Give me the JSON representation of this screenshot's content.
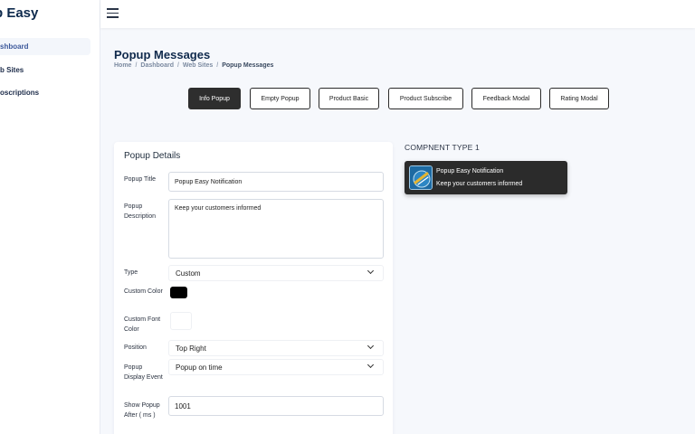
{
  "sidebar": {
    "brand": "p Easy",
    "items": [
      {
        "label": "shboard",
        "active": true
      },
      {
        "label": "b Sites",
        "active": false
      },
      {
        "label": "oscriptions",
        "active": false
      }
    ]
  },
  "header": {
    "menu_icon": "hamburger-icon"
  },
  "page": {
    "title": "Popup Messages",
    "breadcrumb": [
      "Home",
      "Dashboard",
      "Web Sites",
      "Popup Messages"
    ],
    "breadcrumb_separator": "/"
  },
  "tabs": [
    {
      "label": "Info Popup",
      "active": true
    },
    {
      "label": "Empty Popup",
      "active": false
    },
    {
      "label": "Product Basic",
      "active": false
    },
    {
      "label": "Product Subscribe",
      "active": false
    },
    {
      "label": "Feedback Modal",
      "active": false
    },
    {
      "label": "Rating Modal",
      "active": false
    }
  ],
  "form": {
    "title": "Popup Details",
    "popup_title_label": "Popup Title",
    "popup_title_value": "Popup Easy Notification",
    "popup_description_label": "Popup Description",
    "popup_description_value": "Keep your customers informed",
    "type_label": "Type",
    "type_value": "Custom",
    "custom_color_label": "Custom Color",
    "custom_color_value": "#000000",
    "custom_font_color_label": "Custom Font Color",
    "custom_font_color_value": "#ffffff",
    "position_label": "Position",
    "position_value": "Top Right",
    "display_event_label": "Popup Display Event",
    "display_event_value": "Popup on time",
    "show_after_label": "Show Popup After ( ms )",
    "show_after_value": "1001"
  },
  "preview": {
    "component_type": "COMPNENT TYPE 1",
    "toast_title": "Popup Easy Notification",
    "toast_subtitle": "Keep your customers informed",
    "toast_icon": "popup-easy-logo-icon"
  },
  "colors": {
    "accent": "#0e2a4d",
    "active_tab": "#2e2e2e",
    "toast_bg": "#2b2b2b"
  }
}
